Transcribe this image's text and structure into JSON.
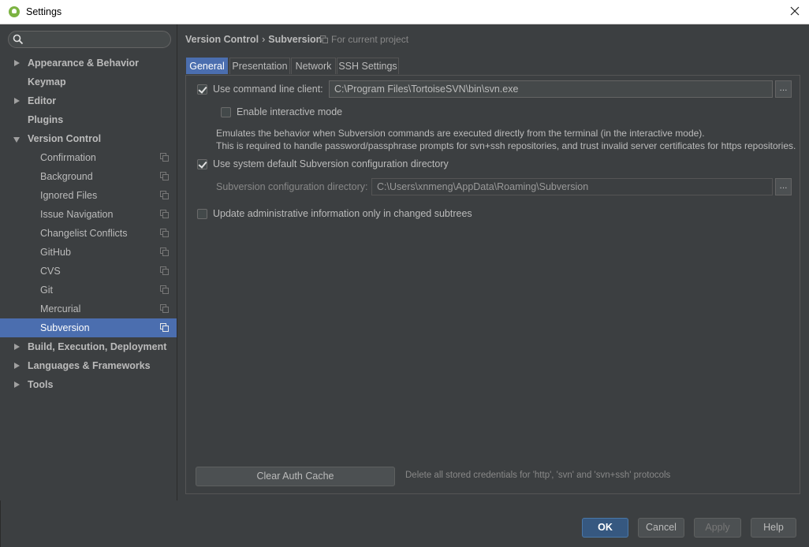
{
  "window": {
    "title": "Settings"
  },
  "search": {
    "placeholder": "",
    "value": ""
  },
  "sidebar": {
    "items": [
      {
        "label": "Appearance & Behavior"
      },
      {
        "label": "Keymap"
      },
      {
        "label": "Editor"
      },
      {
        "label": "Plugins"
      },
      {
        "label": "Version Control"
      },
      {
        "label": "Confirmation"
      },
      {
        "label": "Background"
      },
      {
        "label": "Ignored Files"
      },
      {
        "label": "Issue Navigation"
      },
      {
        "label": "Changelist Conflicts"
      },
      {
        "label": "GitHub"
      },
      {
        "label": "CVS"
      },
      {
        "label": "Git"
      },
      {
        "label": "Mercurial"
      },
      {
        "label": "Subversion"
      },
      {
        "label": "Build, Execution, Deployment"
      },
      {
        "label": "Languages & Frameworks"
      },
      {
        "label": "Tools"
      }
    ]
  },
  "breadcrumb": {
    "parent": "Version Control",
    "separator": "›",
    "current": "Subversion",
    "scope": "For current project"
  },
  "tabs": [
    {
      "label": "General"
    },
    {
      "label": "Presentation"
    },
    {
      "label": "Network"
    },
    {
      "label": "SSH Settings"
    }
  ],
  "general": {
    "use_cmd_client": {
      "label": "Use command line client:",
      "checked": true,
      "value": "C:\\Program Files\\TortoiseSVN\\bin\\svn.exe"
    },
    "interactive_mode": {
      "label": "Enable interactive mode",
      "checked": false
    },
    "description": [
      "Emulates the behavior when Subversion commands are executed directly from the terminal (in the interactive mode).",
      "This is required to handle password/passphrase prompts for svn+ssh repositories, and trust invalid server certificates for https repositories."
    ],
    "use_default_config": {
      "label": "Use system default Subversion configuration directory",
      "checked": true
    },
    "config_dir": {
      "label": "Subversion configuration directory:",
      "value": "C:\\Users\\xnmeng\\AppData\\Roaming\\Subversion"
    },
    "update_admin_info": {
      "label": "Update administrative information only in changed subtrees",
      "checked": false
    },
    "browse_label": "...",
    "clear_auth_cache": {
      "label": "Clear Auth Cache",
      "hint": "Delete all stored credentials for 'http', 'svn' and 'svn+ssh' protocols"
    }
  },
  "footer": {
    "ok": "OK",
    "cancel": "Cancel",
    "apply": "Apply",
    "help": "Help"
  },
  "colors": {
    "selection": "#4b6eaf",
    "background": "#3c3f41",
    "primary_button": "#365880"
  }
}
